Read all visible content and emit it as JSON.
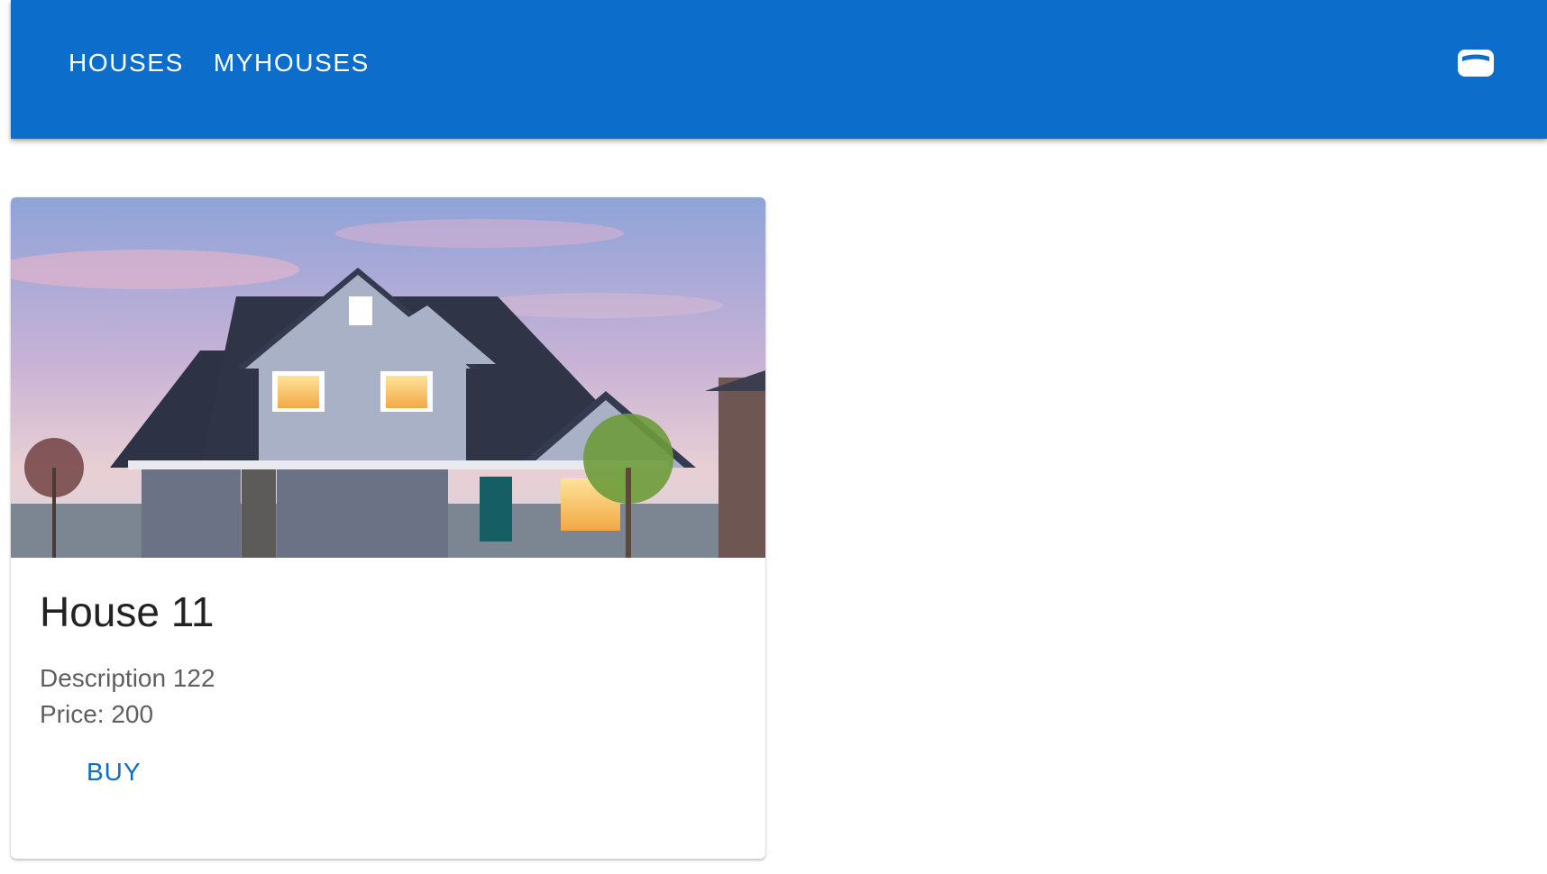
{
  "appbar": {
    "nav": [
      "HOUSES",
      "MYHOUSES"
    ],
    "wallet_icon": "wallet-icon",
    "color": "#0c6dca"
  },
  "listings": [
    {
      "title": "House 11",
      "description": "Description 122",
      "price": "Price: 200",
      "action": "BUY"
    }
  ]
}
